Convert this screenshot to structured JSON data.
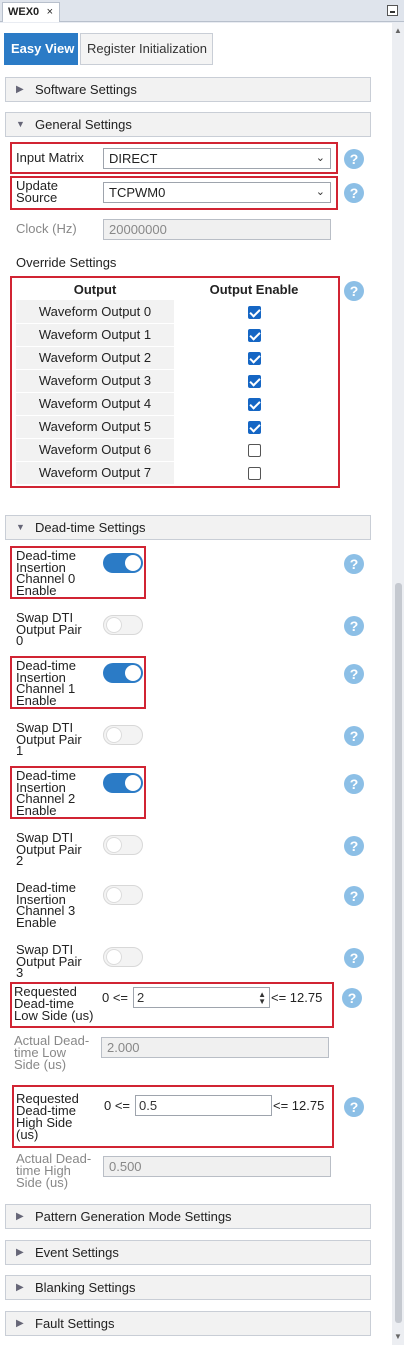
{
  "window": {
    "tab_title": "WEX0",
    "close_glyph": "×"
  },
  "tabs": [
    {
      "label": "Easy View",
      "active": true
    },
    {
      "label": "Register Initialization",
      "active": false
    }
  ],
  "sections": {
    "software": {
      "label": "Software Settings",
      "expanded": false
    },
    "general": {
      "label": "General Settings",
      "expanded": true
    },
    "deadtime": {
      "label": "Dead-time Settings",
      "expanded": true
    },
    "pattern": {
      "label": "Pattern Generation Mode Settings",
      "expanded": false
    },
    "event": {
      "label": "Event Settings",
      "expanded": false
    },
    "blanking": {
      "label": "Blanking Settings",
      "expanded": false
    },
    "fault": {
      "label": "Fault Settings",
      "expanded": false
    }
  },
  "general": {
    "input_matrix": {
      "label": "Input Matrix",
      "value": "DIRECT"
    },
    "update_source": {
      "label": "Update Source",
      "value": "TCPWM0"
    },
    "clock": {
      "label": "Clock (Hz)",
      "value": "20000000"
    },
    "override_label": "Override Settings",
    "override_table": {
      "headers": [
        "Output",
        "Output Enable"
      ],
      "rows": [
        {
          "name": "Waveform Output 0",
          "enabled": true
        },
        {
          "name": "Waveform Output 1",
          "enabled": true
        },
        {
          "name": "Waveform Output 2",
          "enabled": true
        },
        {
          "name": "Waveform Output 3",
          "enabled": true
        },
        {
          "name": "Waveform Output 4",
          "enabled": true
        },
        {
          "name": "Waveform Output 5",
          "enabled": true
        },
        {
          "name": "Waveform Output 6",
          "enabled": false
        },
        {
          "name": "Waveform Output 7",
          "enabled": false
        }
      ]
    }
  },
  "deadtime": {
    "items": [
      {
        "l1": "Dead-time",
        "l2": "Insertion",
        "l3": "Channel 0",
        "l4": "Enable",
        "on": true
      },
      {
        "l1": "Swap DTI",
        "l2": "Output Pair",
        "l3": "0",
        "l4": "",
        "on": false
      },
      {
        "l1": "Dead-time",
        "l2": "Insertion",
        "l3": "Channel 1",
        "l4": "Enable",
        "on": true
      },
      {
        "l1": "Swap DTI",
        "l2": "Output Pair",
        "l3": "1",
        "l4": "",
        "on": false
      },
      {
        "l1": "Dead-time",
        "l2": "Insertion",
        "l3": "Channel 2",
        "l4": "Enable",
        "on": true
      },
      {
        "l1": "Swap DTI",
        "l2": "Output Pair",
        "l3": "2",
        "l4": "",
        "on": false
      },
      {
        "l1": "Dead-time",
        "l2": "Insertion",
        "l3": "Channel 3",
        "l4": "Enable",
        "on": false
      },
      {
        "l1": "Swap DTI",
        "l2": "Output Pair",
        "l3": "3",
        "l4": "",
        "on": false
      }
    ],
    "req_low": {
      "l1": "Requested",
      "l2": "Dead-time",
      "l3": "Low Side (us)",
      "min": "0 <=",
      "value": "2",
      "max": "<= 12.75"
    },
    "act_low": {
      "l1": "Actual Dead-",
      "l2": "time Low",
      "l3": "Side (us)",
      "value": "2.000"
    },
    "req_high": {
      "l1": "Requested",
      "l2": "Dead-time",
      "l3": "High Side",
      "l4": "(us)",
      "min": "0 <=",
      "value": "0.5",
      "max": "<= 12.75"
    },
    "act_high": {
      "l1": "Actual Dead-",
      "l2": "time High",
      "l3": "Side (us)",
      "value": "0.500"
    }
  },
  "help_glyph": "?",
  "colors": {
    "accent": "#2b7bc6",
    "highlight_box": "#d12433",
    "help": "#8cbfe6"
  }
}
